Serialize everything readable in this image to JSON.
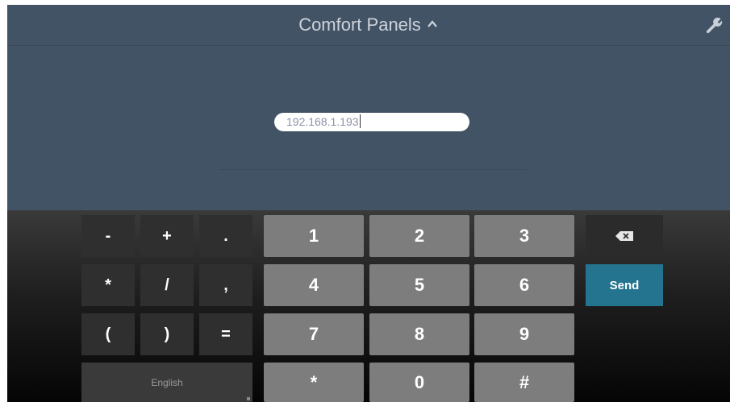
{
  "header": {
    "title": "Comfort Panels",
    "chevron_icon": "chevron-up-icon",
    "settings_icon": "wrench-icon"
  },
  "ip_field": {
    "value": "192.168.1.193"
  },
  "keyboard": {
    "symbols": [
      "-",
      "+",
      ".",
      "*",
      "/",
      ",",
      "(",
      ")",
      "="
    ],
    "digits": [
      "1",
      "2",
      "3",
      "4",
      "5",
      "6",
      "7",
      "8",
      "9",
      "*",
      "0",
      "#"
    ],
    "backspace_icon": "backspace-icon",
    "send_label": "Send",
    "language_label": "English"
  },
  "colors": {
    "header_bg": "#435366",
    "send_key": "#24748f",
    "digit_key": "#7d7d7d"
  }
}
